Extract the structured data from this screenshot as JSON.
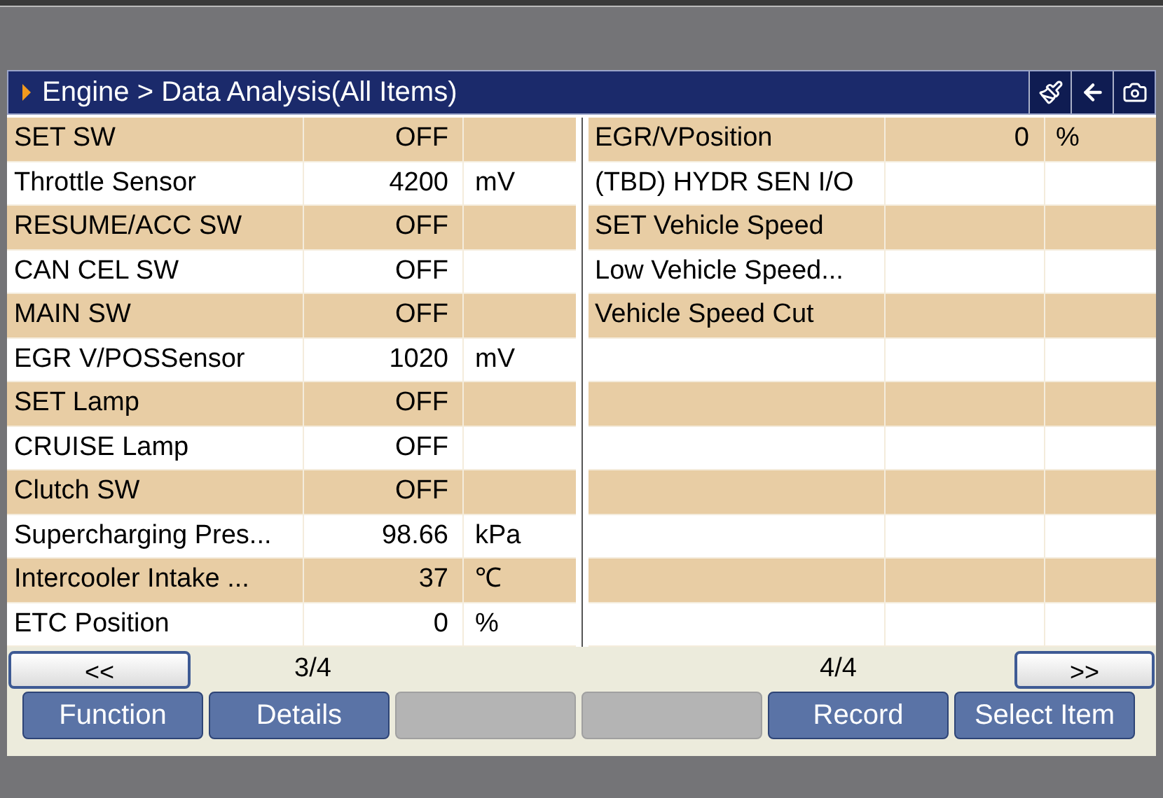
{
  "header": {
    "title": "Engine > Data Analysis(All Items)"
  },
  "left_table": {
    "rows": [
      {
        "name": "SET SW",
        "value": "OFF"
      },
      {
        "name": "Throttle Sensor",
        "value": "4200",
        "unit": "mV"
      },
      {
        "name": "RESUME/ACC SW",
        "value": "OFF"
      },
      {
        "name": "CAN CEL SW",
        "value": "OFF"
      },
      {
        "name": "MAIN SW",
        "value": "OFF"
      },
      {
        "name": "EGR V/POSSensor",
        "value": "1020",
        "unit": "mV"
      },
      {
        "name": "SET Lamp",
        "value": "OFF"
      },
      {
        "name": "CRUISE Lamp",
        "value": "OFF"
      },
      {
        "name": "Clutch SW",
        "value": "OFF"
      },
      {
        "name": "Supercharging Pres...",
        "value": "98.66",
        "unit": "kPa"
      },
      {
        "name": "Intercooler Intake ...",
        "value": "37",
        "unit": "℃"
      },
      {
        "name": "ETC Position",
        "value": "0",
        "unit": "%"
      }
    ]
  },
  "right_table": {
    "rows": [
      {
        "name": "EGR/VPosition",
        "value": "0",
        "unit": "%"
      },
      {
        "name": "(TBD) HYDR SEN I/O"
      },
      {
        "name": "SET Vehicle Speed"
      },
      {
        "name": "Low Vehicle Speed..."
      },
      {
        "name": "Vehicle Speed Cut"
      }
    ]
  },
  "pager": {
    "prev": "<<",
    "left_page": "3/4",
    "right_page": "4/4",
    "next": ">>"
  },
  "buttons": [
    {
      "label": "Function",
      "disabled": false
    },
    {
      "label": "Details",
      "disabled": false
    },
    {
      "disabled": true
    },
    {
      "disabled": true
    },
    {
      "label": "Record",
      "disabled": false
    },
    {
      "label": "Select Item",
      "disabled": false
    }
  ]
}
